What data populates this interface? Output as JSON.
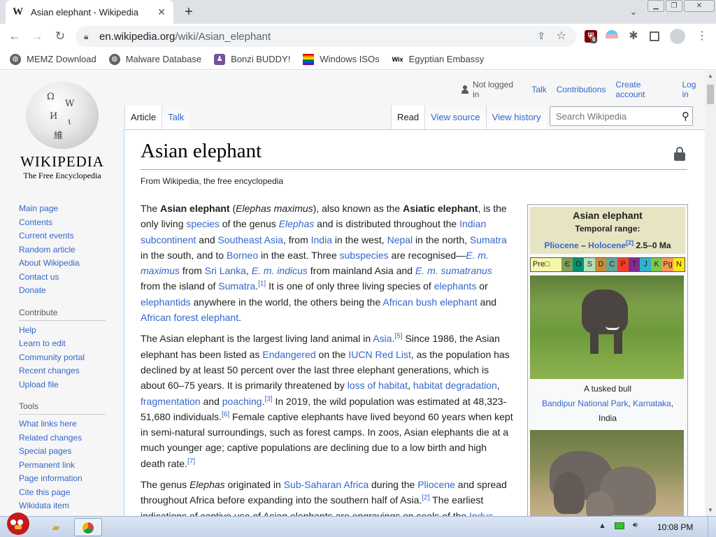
{
  "browser": {
    "tab_title": "Asian elephant - Wikipedia",
    "tab_favicon": "W",
    "url_host": "en.wikipedia.org",
    "url_path": "/wiki/Asian_elephant",
    "extension_badge": "6",
    "bookmarks": [
      {
        "label": "MEMZ Download",
        "icon": "globe-icon"
      },
      {
        "label": "Malware Database",
        "icon": "globe-icon"
      },
      {
        "label": "Bonzi BUDDY!",
        "icon": "bonzi-icon"
      },
      {
        "label": "Windows ISOs",
        "icon": "rainbow-flag-icon"
      },
      {
        "label": "Egyptian Embassy",
        "icon": "wix-icon"
      }
    ]
  },
  "wiki": {
    "logo_word": "WIKIPEDIA",
    "logo_tagline": "The Free Encyclopedia",
    "personal": {
      "not_logged_in": "Not logged in",
      "talk": "Talk",
      "contributions": "Contributions",
      "create_account": "Create account",
      "log_in": "Log in"
    },
    "tabs_left": [
      "Article",
      "Talk"
    ],
    "tabs_right": [
      "Read",
      "View source",
      "View history"
    ],
    "search_placeholder": "Search Wikipedia",
    "nav_main": [
      "Main page",
      "Contents",
      "Current events",
      "Random article",
      "About Wikipedia",
      "Contact us",
      "Donate"
    ],
    "contribute_heading": "Contribute",
    "nav_contribute": [
      "Help",
      "Learn to edit",
      "Community portal",
      "Recent changes",
      "Upload file"
    ],
    "tools_heading": "Tools",
    "nav_tools": [
      "What links here",
      "Related changes",
      "Special pages",
      "Permanent link",
      "Page information",
      "Cite this page",
      "Wikidata item"
    ],
    "title": "Asian elephant",
    "site_sub": "From Wikipedia, the free encyclopedia",
    "infobox": {
      "title": "Asian elephant",
      "temporal_label": "Temporal range:",
      "range_link_1": "Pliocene",
      "range_dash": " – ",
      "range_link_2": "Holocene",
      "range_ref": "[2]",
      "range_value": " 2.5–0 Ma",
      "timescale": [
        {
          "label": "Pre□",
          "color": "#f6f6a8"
        },
        {
          "label": "Є",
          "color": "#7fa056"
        },
        {
          "label": "O",
          "color": "#009270"
        },
        {
          "label": "S",
          "color": "#b3e1b6"
        },
        {
          "label": "D",
          "color": "#cb8c37"
        },
        {
          "label": "C",
          "color": "#67a599"
        },
        {
          "label": "P",
          "color": "#f04028"
        },
        {
          "label": "T",
          "color": "#812b92"
        },
        {
          "label": "J",
          "color": "#34b2c9"
        },
        {
          "label": "K",
          "color": "#7fc64e"
        },
        {
          "label": "Pg",
          "color": "#fd9a52"
        },
        {
          "label": "N",
          "color": "#ffe619"
        }
      ],
      "caption_1": "A tusked bull",
      "caption_link_1": "Bandipur National Park",
      "caption_sep": ", ",
      "caption_link_2": "Karnataka",
      "caption_tail": ",",
      "caption_country": "India"
    }
  },
  "taskbar": {
    "clock": "10:08 PM"
  }
}
